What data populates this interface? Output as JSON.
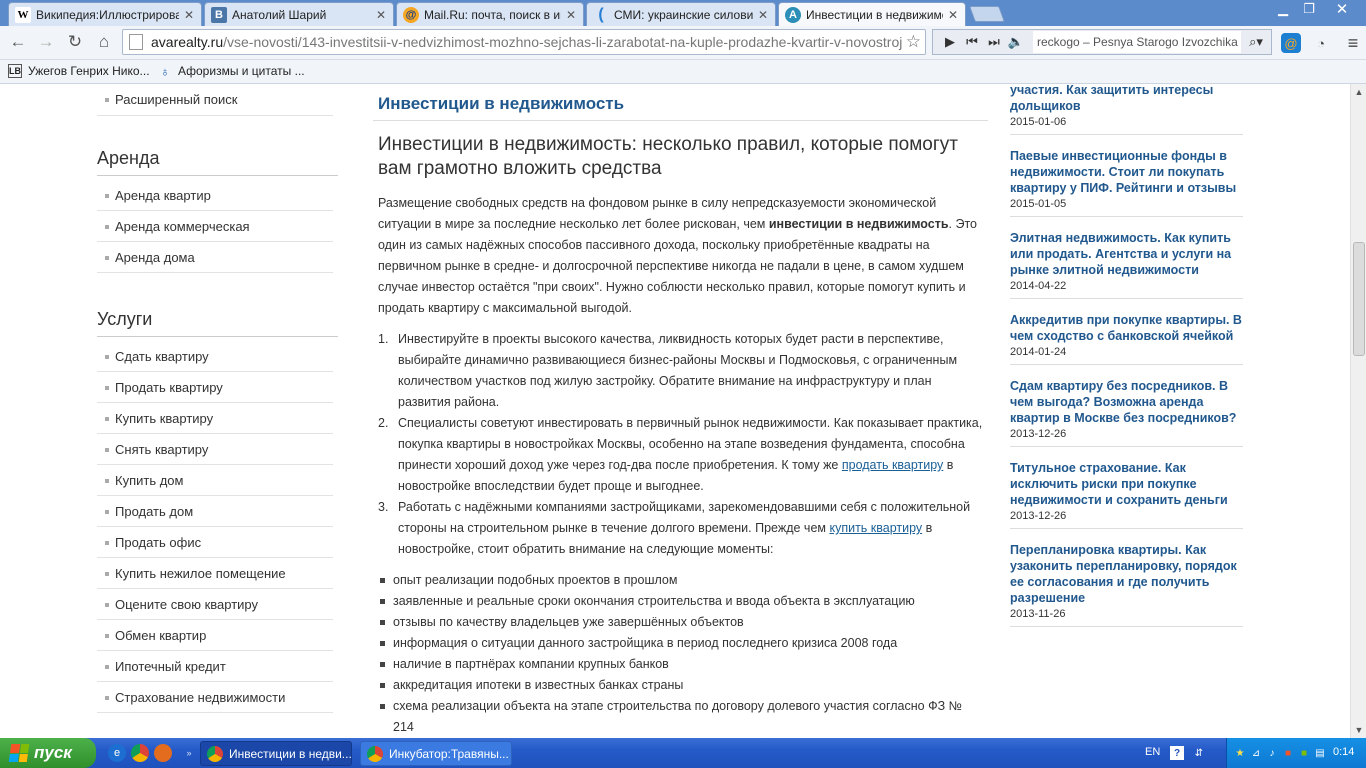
{
  "browser": {
    "tabs": [
      {
        "favicon": "W",
        "label": "Википедия:Иллюстрирование"
      },
      {
        "favicon": "B",
        "label": "Анатолий Шарий"
      },
      {
        "favicon": "@",
        "label": "Mail.Ru: почта, поиск в интернете"
      },
      {
        "favicon": "(",
        "label": "СМИ: украинские силовики"
      },
      {
        "favicon": "A",
        "label": "Инвестиции в недвижимость"
      }
    ],
    "url_domain": "avarealty.ru",
    "url_path": "/vse-novosti/143-investitsii-v-nedvizhimost-mozhno-sejchas-li-zarabotat-na-kuple-prodazhe-kvartir-v-novostroj",
    "media_track": "reckogo – Pesnya Starogo Izvozchika",
    "bookmarks": [
      "Ужегов Генрих Нико...",
      "Афоризмы и цитаты ..."
    ]
  },
  "sidebar": {
    "top_items": [
      "Расширенный поиск"
    ],
    "sections": [
      {
        "title": "Аренда",
        "items": [
          "Аренда квартир",
          "Аренда коммерческая",
          "Аренда дома"
        ]
      },
      {
        "title": "Услуги",
        "items": [
          "Сдать квартиру",
          "Продать квартиру",
          "Купить квартиру",
          "Снять квартиру",
          "Купить дом",
          "Продать дом",
          "Продать офис",
          "Купить нежилое помещение",
          "Оцените свою квартиру",
          "Обмен квартир",
          "Ипотечный кредит",
          "Страхование недвижимости"
        ]
      }
    ]
  },
  "article": {
    "section_title": "Инвестиции в недвижимость",
    "title": "Инвестиции в недвижимость: несколько правил, которые помогут вам грамотно вложить средства",
    "intro_part1": "Размещение свободных средств на фондовом рынке в силу непредсказуемости экономической ситуации в мире за последние несколько лет более рискован, чем ",
    "intro_bold": "инвестиции в недвижимость",
    "intro_part2": ". Это один из самых надёжных способов пассивного дохода, поскольку приобретённые квадраты на первичном рынке в средне- и долгосрочной перспективе никогда не падали в цене, в самом худшем случае инвестор остаётся \"при своих\". Нужно соблюсти несколько правил, которые помогут купить и продать квартиру с максимальной выгодой.",
    "rule1": "Инвестируйте в проекты высокого качества, ликвидность которых будет расти в перспективе, выбирайте динамично развивающиеся бизнес-районы Москвы и Подмосковья, с ограниченным количеством участков под жилую застройку. Обратите внимание на инфраструктуру и план развития района.",
    "rule2_a": "Специалисты советуют инвестировать в первичный рынок недвижимости. Как показывает практика, покупка квартиры в новостройках Москвы, особенно на этапе возведения фундамента, способна принести хороший доход уже через год-два после приобретения. К тому же ",
    "rule2_link": "продать квартиру",
    "rule2_b": " в новостройке впоследствии будет проще и выгоднее.",
    "rule3_a": "Работать с надёжными компаниями застройщиками, зарекомендовавшими себя с положительной стороны на строительном рынке в течение долгого времени. Прежде чем ",
    "rule3_link": "купить квартиру",
    "rule3_b": " в новостройке, стоит обратить внимание на следующие моменты:",
    "bullets": [
      "опыт реализации подобных проектов в прошлом",
      "заявленные и реальные сроки окончания строительства и ввода объекта в эксплуатацию",
      "отзывы по качеству владельцев уже завершённых объектов",
      "информация о ситуации данного застройщика в период последнего кризиса 2008 года",
      "наличие в партнёрах компании крупных банков",
      "аккредитация ипотеки в известных банках страны",
      "схема реализации объекта на этапе строительства по договору долевого участия согласно ФЗ № 214"
    ]
  },
  "news": [
    {
      "title": "участия. Как защитить интересы дольщиков",
      "date": "2015-01-06"
    },
    {
      "title": "Паевые инвестиционные фонды в недвижимости. Стоит ли покупать квартиру у ПИФ. Рейтинги и отзывы",
      "date": "2015-01-05"
    },
    {
      "title": "Элитная недвижимость. Как купить или продать. Агентства и услуги на рынке элитной недвижимости",
      "date": "2014-04-22"
    },
    {
      "title": "Аккредитив при покупке квартиры. В чем сходство с банковской ячейкой",
      "date": "2014-01-24"
    },
    {
      "title": "Сдам квартиру без посредников. В чем выгода? Возможна аренда квартир в Москве без посредников?",
      "date": "2013-12-26"
    },
    {
      "title": "Титульное страхование. Как исключить риски при покупке недвижимости и сохранить деньги",
      "date": "2013-12-26"
    },
    {
      "title": "Перепланировка квартиры. Как узаконить перепланировку, порядок ее согласования и где получить разрешение",
      "date": "2013-11-26"
    }
  ],
  "taskbar": {
    "start_label": "пуск",
    "tasks": [
      "Инвестиции в недви...",
      "Инкубатор:Травяны..."
    ],
    "language": "EN",
    "clock": "0:14"
  }
}
